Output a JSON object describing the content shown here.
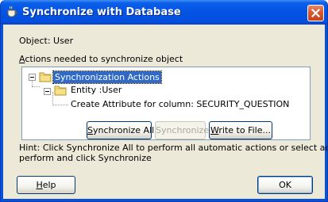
{
  "window": {
    "title": "Synchronize with Database"
  },
  "labels": {
    "object": "Object: User",
    "actions_prefix": "A",
    "actions_rest": "ctions needed to synchronize object",
    "hint_line1": "Hint: Click Synchronize All to perform all automatic actions or select actions to",
    "hint_line2": "perform and click Synchronize"
  },
  "tree": {
    "root": "Synchronization Actions",
    "entity": "Entity :User",
    "action": "Create Attribute for column: SECURITY_QUESTION"
  },
  "buttons": {
    "sync_all_prefix": "S",
    "sync_all_rest": "ynchronize All",
    "sync": "Synchronize",
    "write_prefix": "W",
    "write_rest": "rite to File...",
    "help_prefix": "H",
    "help_rest": "elp",
    "ok": "OK"
  },
  "colors": {
    "titlebar": "#0453e4",
    "selection": "#316ac5",
    "dialog_bg": "#ece9d8"
  },
  "icons": {
    "app": "cup-icon",
    "close": "close-icon",
    "folder": "folder-icon"
  }
}
